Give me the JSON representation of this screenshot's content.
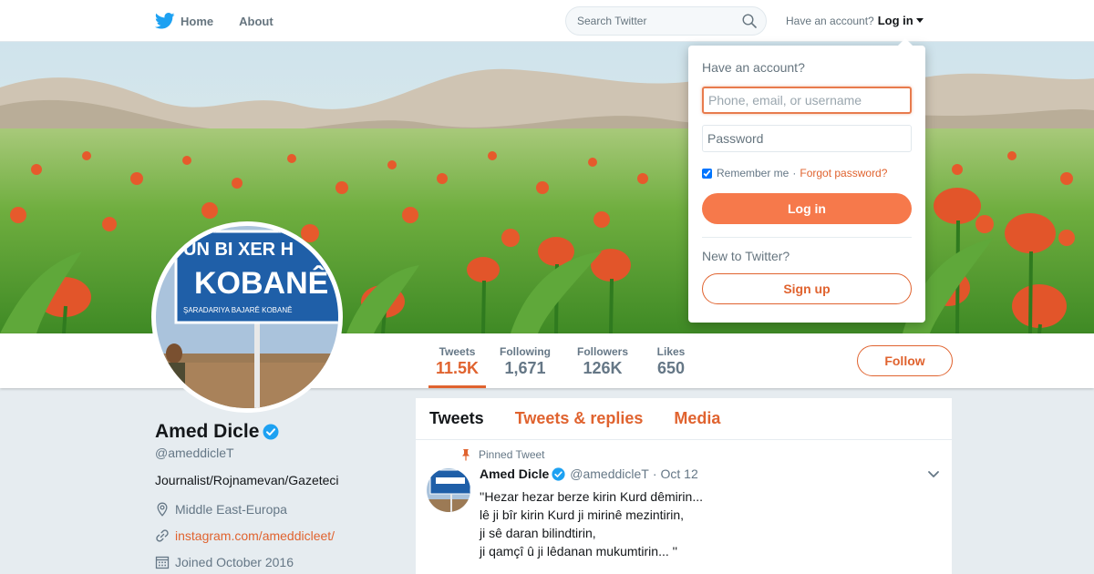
{
  "nav": {
    "home_label": "Home",
    "about_label": "About",
    "search_placeholder": "Search Twitter",
    "account_prompt": "Have an account?",
    "login_label": "Log in"
  },
  "profile": {
    "name": "Amed Dicle",
    "handle": "@ameddicleT",
    "bio": "Journalist/Rojnamevan/Gazeteci",
    "location": "Middle East-Europa",
    "website": "instagram.com/ameddicleet/",
    "joined": "Joined October 2016",
    "avatar_sign_lines": [
      "UN BI XER H",
      "KOBANÊ",
      "ŞARADARIYA BAJARÊ KOBANÊ"
    ]
  },
  "stats": [
    {
      "label": "Tweets",
      "value": "11.5K"
    },
    {
      "label": "Following",
      "value": "1,671"
    },
    {
      "label": "Followers",
      "value": "126K"
    },
    {
      "label": "Likes",
      "value": "650"
    }
  ],
  "follow_label": "Follow",
  "tabs": [
    "Tweets",
    "Tweets & replies",
    "Media"
  ],
  "pinned_tweet": {
    "pinned_label": "Pinned Tweet",
    "name": "Amed Dicle",
    "handle": "@ameddicleT",
    "separator": "·",
    "time": "Oct 12",
    "lines": [
      "''Hezar hezar berze kirin Kurd dêmirin...",
      "lê ji bîr kirin Kurd ji mirinê mezintirin,",
      "ji sê daran bilindtirin,",
      "ji qamçî û ji lêdanan mukumtirin... ''"
    ]
  },
  "login_dropdown": {
    "heading": "Have an account?",
    "username_placeholder": "Phone, email, or username",
    "password_placeholder": "Password",
    "remember_label": "Remember me",
    "separator": "·",
    "forgot_label": "Forgot password?",
    "login_button": "Log in",
    "new_prompt": "New to Twitter?",
    "signup_button": "Sign up"
  },
  "colors": {
    "accent": "#e0632f",
    "login_button_bg": "#f6794b",
    "twitter_blue": "#1da1f2",
    "page_bg": "#e6ecf0"
  }
}
